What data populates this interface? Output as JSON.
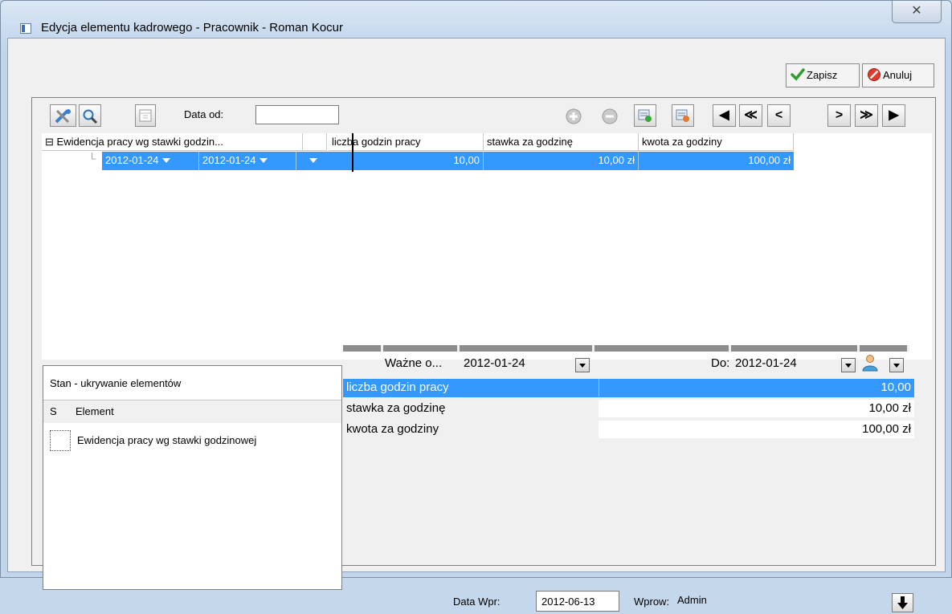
{
  "window": {
    "title": "Edycja elementu kadrowego - Pracownik - Roman Kocur",
    "close_glyph": "✕"
  },
  "actions": {
    "save_label": "Zapisz",
    "cancel_label": "Anuluj"
  },
  "toolbar": {
    "date_from_label": "Data od:",
    "date_from_value": "",
    "nav": [
      "◀",
      "≪",
      "<",
      ">",
      "≫",
      "▶"
    ]
  },
  "grid": {
    "group_header": "Ewidencja pracy wg stawki godzin...",
    "group_toggle": "⊟",
    "columns": [
      "liczba godzin pracy",
      "stawka za godzinę",
      "kwota za godziny"
    ],
    "row": {
      "date_from": "2012-01-24",
      "date_to": "2012-01-24",
      "hours": "10,00",
      "rate": "10,00 zł",
      "amount": "100,00 zł"
    }
  },
  "state_panel": {
    "title": "Stan - ukrywanie elementów",
    "col_s": "S",
    "col_element": "Element",
    "items": [
      {
        "label": "Ewidencja pracy wg stawki godzinowej",
        "checked": false
      }
    ]
  },
  "details": {
    "valid_from_label": "Ważne o...",
    "valid_from_value": "2012-01-24",
    "to_label": "Do:",
    "to_value": "2012-01-24",
    "rows": [
      {
        "label": "liczba godzin pracy",
        "value": "10,00",
        "selected": true
      },
      {
        "label": "stawka za godzinę",
        "value": "10,00 zł",
        "selected": false
      },
      {
        "label": "kwota za godziny",
        "value": "100,00 zł",
        "selected": false
      }
    ]
  },
  "footer": {
    "entry_date_label": "Data Wpr:",
    "entry_date_value": "2012-06-13",
    "entered_by_label": "Wprow:",
    "entered_by_value": "Admin"
  },
  "colors": {
    "selection": "#3399ff",
    "window_chrome": "#c4d7eb",
    "client_bg": "#f0f0f0"
  }
}
